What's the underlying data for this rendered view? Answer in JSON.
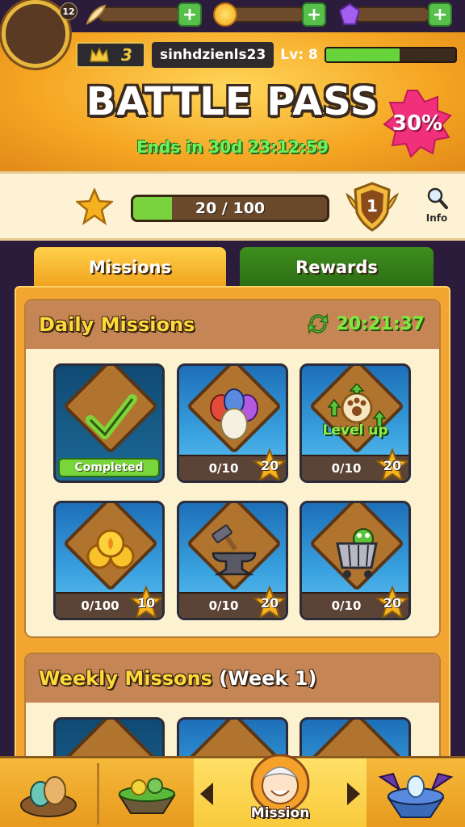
{
  "player": {
    "avatar_level": "12",
    "crowns": "3",
    "username": "sinhdzienls23",
    "level_label": "Lv: 8",
    "xp_progress": 0.57
  },
  "currencies": [
    {
      "name": "feather",
      "icon": "feather-icon",
      "progress": 0
    },
    {
      "name": "coin",
      "icon": "gold-coin-icon",
      "progress": 0
    },
    {
      "name": "gem",
      "icon": "purple-gem-icon",
      "progress": 0
    }
  ],
  "battle_pass": {
    "title": "BATTLE PASS",
    "ends_text": "Ends in 30d 23:12:59",
    "discount": "30%",
    "progress_text": "20 / 100",
    "progress": 0.2,
    "tier": "1",
    "info_label": "Info"
  },
  "tabs": [
    {
      "label": "Missions",
      "active": true
    },
    {
      "label": "Rewards",
      "active": false
    }
  ],
  "daily": {
    "title": "Daily Missions",
    "timer": "20:21:37",
    "missions": [
      {
        "icon": "dragon-nest-icon",
        "progress": "",
        "reward": "",
        "status": "Completed"
      },
      {
        "icon": "dragon-eggs-icon",
        "progress": "0/10",
        "reward": "20",
        "status": ""
      },
      {
        "icon": "paw-level-up-icon",
        "progress": "0/10",
        "reward": "20",
        "status": "",
        "overlay": "Level up"
      },
      {
        "icon": "gold-coins-icon",
        "progress": "0/100",
        "reward": "10",
        "status": ""
      },
      {
        "icon": "anvil-hammer-icon",
        "progress": "0/10",
        "reward": "20",
        "status": ""
      },
      {
        "icon": "shopping-cart-icon",
        "progress": "0/10",
        "reward": "20",
        "status": ""
      }
    ]
  },
  "weekly": {
    "title": "Weekly Missons",
    "week_label": "(Week 1)"
  },
  "nav": {
    "items": [
      {
        "icon": "egg-nest-icon"
      },
      {
        "icon": "dragon-island-icon"
      },
      {
        "icon": "mission-character-icon",
        "label": "Mission"
      },
      {
        "icon": "dragon-arena-icon"
      }
    ]
  },
  "colors": {
    "accent_orange": "#f5a623",
    "green": "#67d43b",
    "pink": "#f0307a",
    "gold": "#ffd93a"
  }
}
